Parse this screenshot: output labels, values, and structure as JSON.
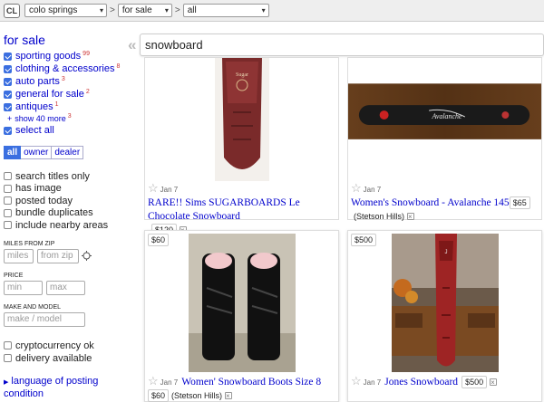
{
  "header": {
    "logo": "CL",
    "location": "colo springs",
    "category": "for sale",
    "subcategory": "all",
    "separator": ">"
  },
  "sidebar": {
    "title": "for sale",
    "categories": [
      {
        "label": "sporting goods",
        "count": "99"
      },
      {
        "label": "clothing & accessories",
        "count": "8"
      },
      {
        "label": "auto parts",
        "count": "3"
      },
      {
        "label": "general for sale",
        "count": "2"
      },
      {
        "label": "antiques",
        "count": "1"
      }
    ],
    "show_more": {
      "label": "show 40 more",
      "count": "3"
    },
    "select_all": "select all",
    "seller_types": [
      "all",
      "owner",
      "dealer"
    ],
    "filters": [
      "search titles only",
      "has image",
      "posted today",
      "bundle duplicates",
      "include nearby areas"
    ],
    "miles_label": "MILES FROM ZIP",
    "miles_placeholder": "miles",
    "zip_placeholder": "from zip",
    "price_label": "PRICE",
    "min_placeholder": "min",
    "max_placeholder": "max",
    "make_label": "MAKE AND MODEL",
    "make_placeholder": "make / model",
    "extra_filters": [
      "cryptocurrency ok",
      "delivery available"
    ],
    "language_link_1": "language of posting",
    "language_link_2": "condition"
  },
  "search": {
    "query": "snowboard",
    "collapse": "«"
  },
  "listings": [
    {
      "date": "Jan 7",
      "title": "RARE!! Sims SUGARBOARDS Le Chocolate Snowboard",
      "price": "$120",
      "location": ""
    },
    {
      "date": "Jan 7",
      "title": "Women's Snowboard - Avalanche 145",
      "price": "$65",
      "location": "(Stetson Hills)"
    },
    {
      "date": "Jan 7",
      "title": "Women' Snowboard Boots Size 8",
      "price": "$60",
      "location": "(Stetson Hills)"
    },
    {
      "date": "Jan 7",
      "title": "Jones Snowboard",
      "price": "$500",
      "location": ""
    }
  ],
  "colors": {
    "link": "#0000cc",
    "accent": "#3b6fe0",
    "count": "#cc3333"
  },
  "icons": [
    "star-icon",
    "hide-icon",
    "target-icon",
    "chevron-down-icon",
    "plus-icon",
    "triangle-right-icon"
  ]
}
